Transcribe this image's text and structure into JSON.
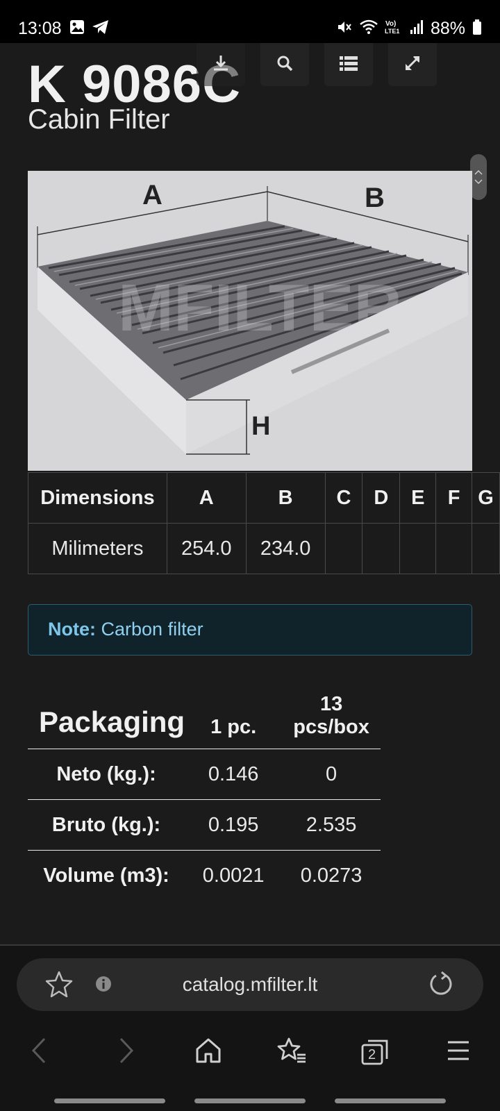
{
  "status_bar": {
    "time": "13:08",
    "battery": "88%",
    "icons": [
      "gallery-icon",
      "telegram-icon",
      "mute-icon",
      "wifi-icon",
      "volte-icon",
      "signal-icon",
      "battery-icon"
    ]
  },
  "product": {
    "code": "K 9086C",
    "type": "Cabin Filter",
    "image_labels": {
      "a": "A",
      "b": "B",
      "h": "H"
    },
    "watermark": "MFILTER"
  },
  "toolbar": {
    "icons": [
      "download-icon",
      "search-icon",
      "list-icon",
      "expand-icon"
    ]
  },
  "dimensions": {
    "headers": [
      "Dimensions",
      "A",
      "B",
      "C",
      "D",
      "E",
      "F",
      "G"
    ],
    "row": [
      "Milimeters",
      "254.0",
      "234.0",
      "",
      "",
      "",
      "",
      ""
    ]
  },
  "note": {
    "label": "Note:",
    "text": "Carbon filter"
  },
  "packaging": {
    "title": "Packaging",
    "col1": "1 pc.",
    "col2_line1": "13",
    "col2_line2": "pcs/box",
    "rows": [
      {
        "label": "Neto (kg.):",
        "v1": "0.146",
        "v2": "0"
      },
      {
        "label": "Bruto (kg.):",
        "v1": "0.195",
        "v2": "2.535"
      },
      {
        "label": "Volume (m3):",
        "v1": "0.0021",
        "v2": "0.0273"
      }
    ]
  },
  "browser": {
    "url": "catalog.mfilter.lt",
    "tab_count": "2"
  }
}
